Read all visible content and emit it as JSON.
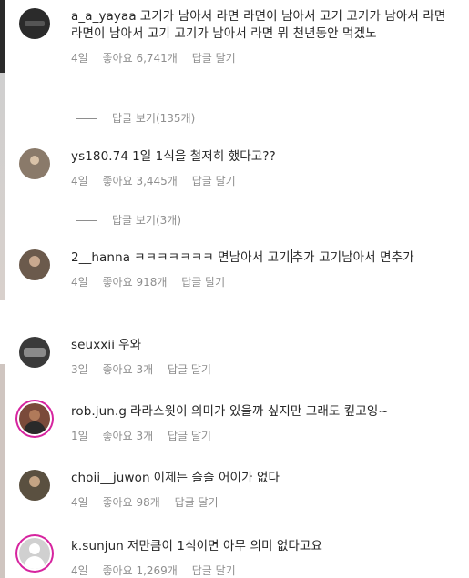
{
  "comments": [
    {
      "username": "a_a_yayaa",
      "text": "고기가 남아서 라면 라면이 남아서 고기 고기가 남아서 라면 라면이 남아서 고기 고기가 남아서 라면 뭐 천년동안 먹겠노",
      "time": "4일",
      "likes": "좋아요 6,741개",
      "reply_label": "답글 달기",
      "view_replies": "답글 보기(135개)",
      "avatar_color": "#2b2b2b"
    },
    {
      "username": "ys180.74",
      "text": "1일 1식을 철저히 했다고??",
      "time": "4일",
      "likes": "좋아요 3,445개",
      "reply_label": "답글 달기",
      "view_replies": "답글 보기(3개)",
      "avatar_color": "#8a7a6a"
    },
    {
      "username": "2__hanna",
      "text_before": "ㅋㅋㅋㅋㅋㅋㅋ 면남아서 고기",
      "text_after": "추가 고기남아서 면추가",
      "time": "4일",
      "likes": "좋아요 918개",
      "reply_label": "답글 달기",
      "avatar_color": "#6b5a4c"
    },
    {
      "username": "seuxxii",
      "text": "우와",
      "time": "3일",
      "likes": "좋아요 3개",
      "reply_label": "답글 달기",
      "avatar_color": "#3a3a3a"
    },
    {
      "username": "rob.jun.g",
      "text": "라라스윗이 의미가 있을까 싶지만 그래도 킾고잉~",
      "time": "1일",
      "likes": "좋아요 3개",
      "reply_label": "답글 달기",
      "avatar_color": "#7a4a3a"
    },
    {
      "username": "choii__juwon",
      "text": "이제는 슬슬 어이가 없다",
      "time": "4일",
      "likes": "좋아요 98개",
      "reply_label": "답글 달기",
      "avatar_color": "#5a5040"
    },
    {
      "username": "k.sunjun",
      "text": "저만큼이 1식이면 아무 의미 없다고요",
      "time": "4일",
      "likes": "좋아요 1,269개",
      "reply_label": "답글 달기",
      "avatar_color": "#d0d0d0"
    }
  ]
}
